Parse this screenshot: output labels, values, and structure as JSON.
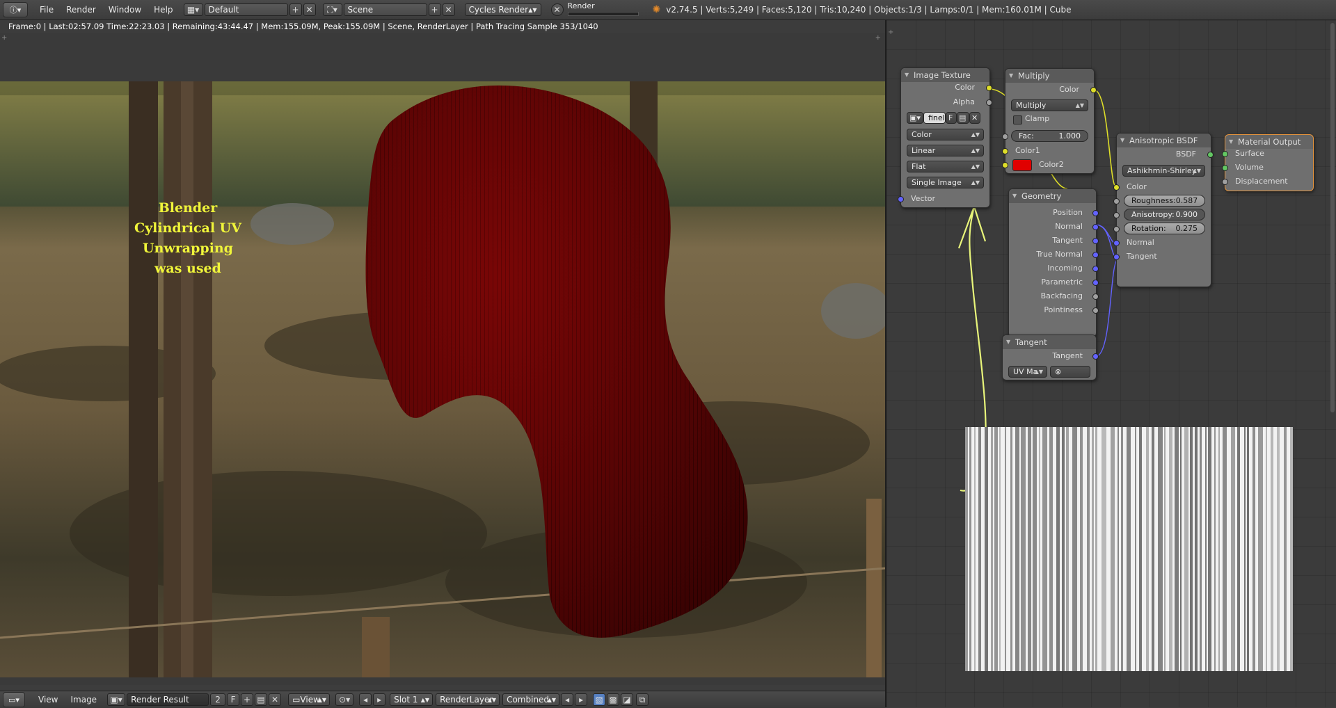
{
  "topbar": {
    "info_icon": "info-icon",
    "menus": [
      "File",
      "Render",
      "Window",
      "Help"
    ],
    "layout": "Default",
    "scene": "Scene",
    "engine": "Cycles Render",
    "render_label": "Render",
    "stats": "v2.74.5 | Verts:5,249 | Faces:5,120 | Tris:10,240 | Objects:1/3 | Lamps:0/1 | Mem:160.01M | Cube"
  },
  "image_editor": {
    "render_info": "Frame:0 | Last:02:57.09 Time:22:23.03 | Remaining:43:44.47 | Mem:155.09M, Peak:155.09M | Scene, RenderLayer | Path Tracing Sample 353/1040",
    "overlay_lines": [
      "Blender",
      "Cylindrical UV Unwrapping",
      "was used"
    ]
  },
  "bottombar": {
    "view": "View",
    "image": "Image",
    "image_name": "Render Result",
    "users": "2",
    "fake_user": "F",
    "view2": "View",
    "slot": "Slot 1",
    "layer": "RenderLayer",
    "pass": "Combined"
  },
  "nodes": {
    "image_texture": {
      "title": "Image Texture",
      "out_color": "Color",
      "out_alpha": "Alpha",
      "image": "finel",
      "fake_user": "F",
      "color_space": "Color",
      "interpolation": "Linear",
      "projection": "Flat",
      "source": "Single Image",
      "in_vector": "Vector"
    },
    "multiply": {
      "title": "Multiply",
      "out_color": "Color",
      "blend": "Multiply",
      "clamp": "Clamp",
      "fac_label": "Fac:",
      "fac_value": "1.000",
      "color1": "Color1",
      "color2": "Color2",
      "color2_swatch": "#e00000"
    },
    "geometry": {
      "title": "Geometry",
      "outputs": [
        "Position",
        "Normal",
        "Tangent",
        "True Normal",
        "Incoming",
        "Parametric",
        "Backfacing",
        "Pointiness"
      ]
    },
    "tangent": {
      "title": "Tangent",
      "out": "Tangent",
      "mode": "UV Ma"
    },
    "aniso": {
      "title": "Anisotropic BSDF",
      "out": "BSDF",
      "distribution": "Ashikhmin-Shirley",
      "color": "Color",
      "roughness_label": "Roughness:",
      "roughness": "0.587",
      "anisotropy_label": "Anisotropy:",
      "anisotropy": "0.900",
      "rotation_label": "Rotation:",
      "rotation": "0.275",
      "normal": "Normal",
      "tangent": "Tangent"
    },
    "output": {
      "title": "Material Output",
      "surface": "Surface",
      "volume": "Volume",
      "displacement": "Displacement"
    }
  },
  "colors": {
    "arrow": "#e8f57a",
    "cloth": "#6a0505"
  }
}
